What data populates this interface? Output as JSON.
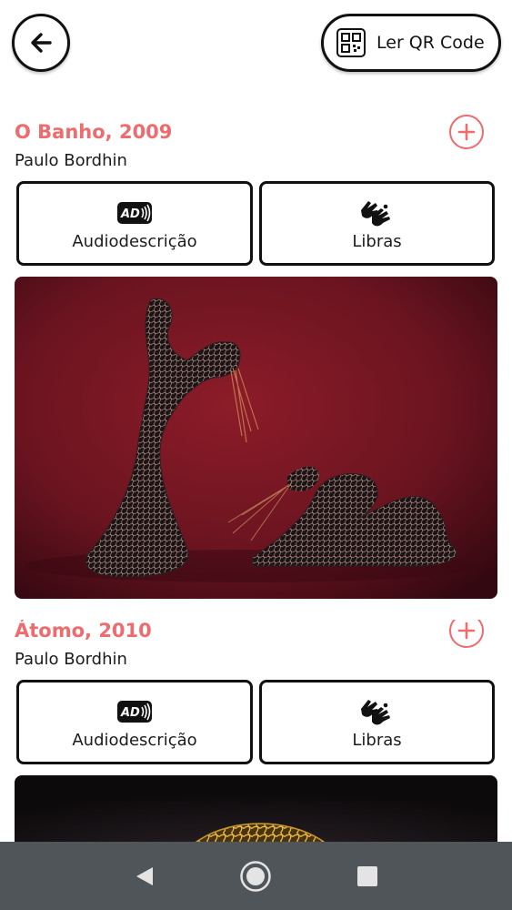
{
  "header": {
    "back_icon": "arrow-left-icon",
    "qr_icon": "qr-code-icon",
    "qr_label": "Ler QR Code"
  },
  "artworks": [
    {
      "title": "O Banho, 2009",
      "author": "Paulo Bordhin",
      "audio_label": "Audiodescrição",
      "libras_label": "Libras",
      "image": "wire-sculpture-red-background"
    },
    {
      "title": "Átomo, 2010",
      "author": "Paulo Bordhin",
      "audio_label": "Audiodescrição",
      "libras_label": "Libras",
      "image": "golden-wire-sphere-dark-background"
    }
  ],
  "colors": {
    "accent": "#ee6b6e",
    "navbar": "#50555a"
  },
  "navbar": {
    "back": "nav-back-icon",
    "home": "nav-home-icon",
    "recents": "nav-recents-icon"
  }
}
